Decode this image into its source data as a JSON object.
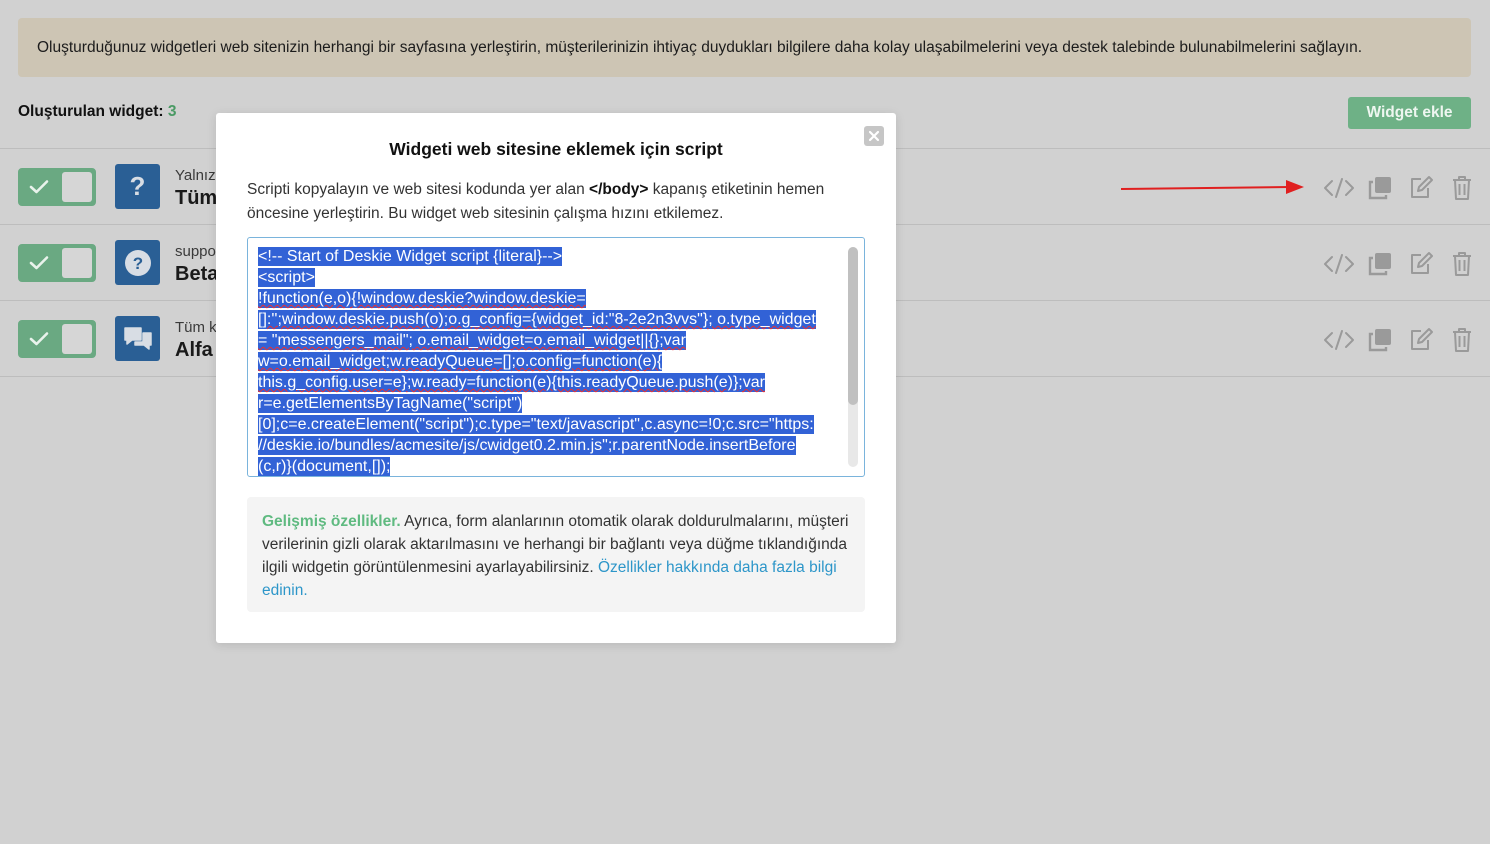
{
  "banner": {
    "text": "Oluşturduğunuz widgetleri web sitenizin herhangi bir sayfasına yerleştirin, müşterilerinizin ihtiyaç duydukları bilgilere daha kolay ulaşabilmelerini veya destek talebinde bulunabilmelerini sağlayın."
  },
  "header": {
    "count_label": "Oluşturulan widget:",
    "count_value": "3",
    "add_button": "Widget ekle"
  },
  "widgets": [
    {
      "subtitle": "Yalnız",
      "title": "Tüm",
      "icon": "question-icon",
      "enabled": true
    },
    {
      "subtitle": "suppo",
      "title": "Beta",
      "icon": "question-circle-icon",
      "enabled": true
    },
    {
      "subtitle": "Tüm k",
      "title": "Alfa",
      "icon": "chat-icon",
      "enabled": true
    }
  ],
  "modal": {
    "title": "Widgeti web sitesine eklemek için script",
    "desc_before": "Scripti kopyalayın ve web sitesi kodunda yer alan ",
    "desc_tag": "</body>",
    "desc_after": " kapanış etiketinin hemen öncesine yerleştirin. Bu widget web sitesinin çalışma hızını etkilemez.",
    "code_lines": [
      "<!-- Start of Deskie Widget script {literal}-->",
      "<script>",
      "!function(e,o){!window.deskie?window.deskie=",
      "[]:'';window.deskie.push(o);o.g_config={widget_id:\"8-2e2n3vvs\"}; o.type_widget",
      "= \"messengers_mail\"; o.email_widget=o.email_widget||{};var",
      "w=o.email_widget;w.readyQueue=[];o.config=function(e){",
      "this.g_config.user=e};w.ready=function(e){this.readyQueue.push(e)};var",
      "r=e.getElementsByTagName(\"script\")",
      "[0];c=e.createElement(\"script\");c.type=\"text/javascript\",c.async=!0;c.src=\"https:",
      "//deskie.io/bundles/acmesite/js/cwidget0.2.min.js\";r.parentNode.insertBefore",
      "(c,r)}(document,[]);"
    ],
    "adv_label": "Gelişmiş özellikler.",
    "adv_text": " Ayrıca, form alanlarının otomatik olarak doldurulmalarını, müşteri verilerinin gizli olarak aktarılmasını ve herhangi bir bağlantı veya düğme tıklandığında ilgili widgetin görüntülenmesini ayarlayabilirsiniz. ",
    "adv_link": "Özellikler hakkında daha fazla bilgi edinin."
  },
  "colors": {
    "accent_green": "#6aa982",
    "widget_icon_bg": "#2a5f95",
    "selection": "#3262d6",
    "link": "#2d96c9",
    "arrow": "#e02020"
  }
}
